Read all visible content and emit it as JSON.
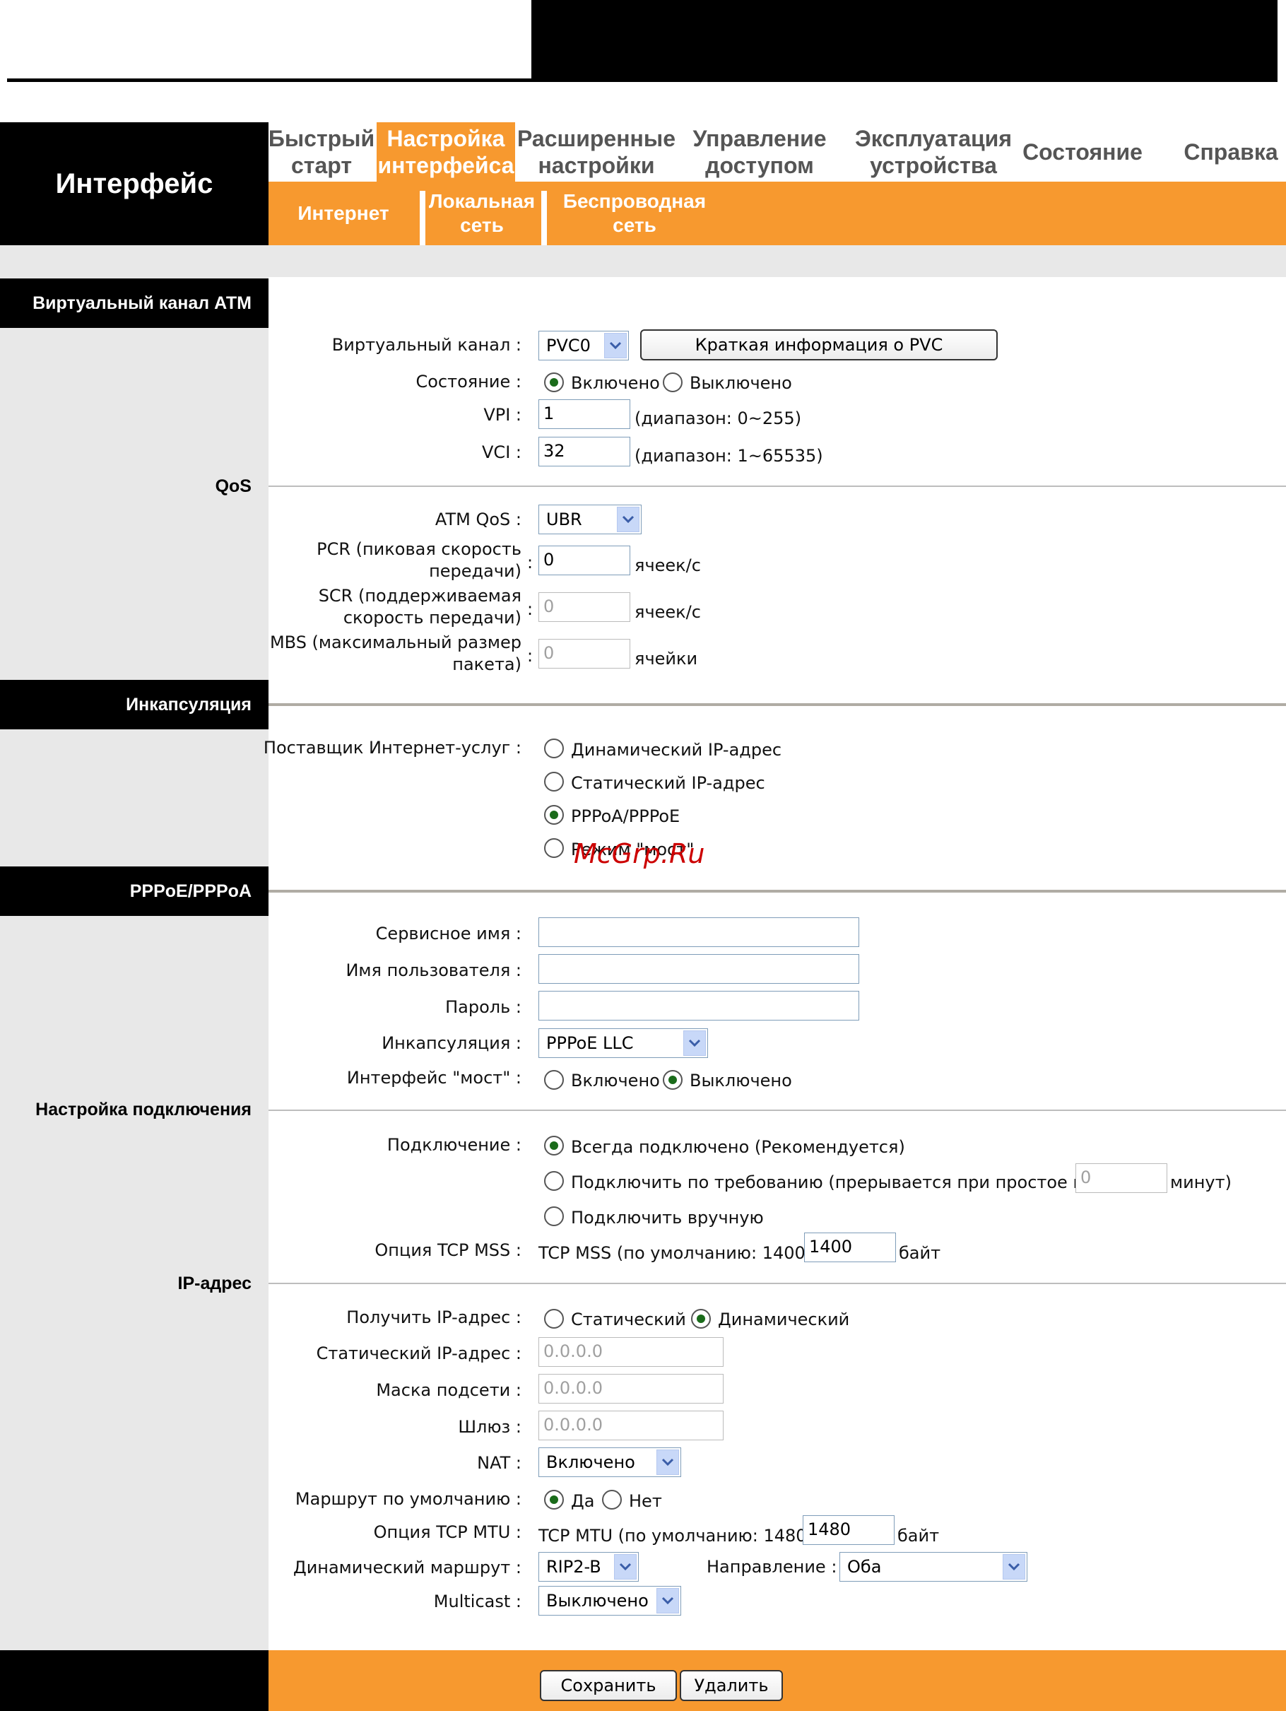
{
  "nav": {
    "brand": "Интерфейс",
    "tabs": [
      {
        "line1": "Быстрый",
        "line2": "старт"
      },
      {
        "line1": "Настройка",
        "line2": "интерфейса"
      },
      {
        "line1": "Расширенные",
        "line2": "настройки"
      },
      {
        "line1": "Управление",
        "line2": "доступом"
      },
      {
        "line1": "Эксплуатация",
        "line2": "устройства"
      },
      {
        "line1": "Состояние",
        "line2": ""
      },
      {
        "line1": "Справка",
        "line2": ""
      }
    ],
    "subtabs": [
      {
        "line1": "Интернет",
        "line2": ""
      },
      {
        "line1": "Локальная",
        "line2": "сеть"
      },
      {
        "line1": "Беспроводная",
        "line2": "сеть"
      }
    ]
  },
  "sections": {
    "atm": "Виртуальный канал АТМ",
    "qos": "QoS",
    "encap": "Инкапсуляция",
    "pppoe": "PPPoE/PPPoA",
    "conn": "Настройка подключения",
    "ip": "IP-адрес"
  },
  "atm": {
    "vc_label": "Виртуальный канал",
    "vc_value": "PVC0",
    "pvc_button": "Краткая информация о PVC",
    "status_label": "Состояние",
    "status_on": "Включено",
    "status_off": "Выключено",
    "vpi_label": "VPI",
    "vpi_value": "1",
    "vpi_range": "(диапазон: 0~255)",
    "vci_label": "VCI",
    "vci_value": "32",
    "vci_range": "(диапазон: 1~65535)"
  },
  "qos": {
    "atm_qos_label": "ATM QoS",
    "atm_qos_value": "UBR",
    "pcr_label_1": "PCR (пиковая скорость",
    "pcr_label_2": "передачи)",
    "pcr_value": "0",
    "pcr_unit": "ячеек/с",
    "scr_label_1": "SCR (поддерживаемая",
    "scr_label_2": "скорость передачи)",
    "scr_value": "0",
    "scr_unit": "ячеек/с",
    "mbs_label_1": "MBS (максимальный размер",
    "mbs_label_2": "пакета)",
    "mbs_value": "0",
    "mbs_unit": "ячейки"
  },
  "encap": {
    "isp_label": "Поставщик Интернет-услуг",
    "opt_dynamic": "Динамический IP-адрес",
    "opt_static": "Статический IP-адрес",
    "opt_pppoa": "PPPoA/PPPoE",
    "opt_bridge": "Режим \"мост\""
  },
  "watermark": "McGrp.Ru",
  "pppoe": {
    "service_label": "Сервисное имя",
    "service_value": "",
    "user_label": "Имя пользователя",
    "user_value": "",
    "pass_label": "Пароль",
    "pass_value": "",
    "encap_label": "Инкапсуляция",
    "encap_value": "PPPoE LLC",
    "bridge_label": "Интерфейс \"мост\"",
    "bridge_on": "Включено",
    "bridge_off": "Выключено"
  },
  "conn": {
    "label": "Подключение",
    "always": "Всегда подключено (Рекомендуется)",
    "ondemand": "Подключить по требованию (прерывается при простое в",
    "idle_value": "0",
    "idle_unit": "минут)",
    "manual": "Подключить вручную",
    "mss_label": "Опция TCP MSS",
    "mss_default": "TCP MSS (по умолчанию: 1400)",
    "mss_value": "1400",
    "mss_unit": "байт"
  },
  "ip": {
    "get_label": "Получить IP-адрес",
    "get_static": "Статический",
    "get_dynamic": "Динамический",
    "static_label": "Статический IP-адрес",
    "static_value": "0.0.0.0",
    "mask_label": "Маска подсети",
    "mask_value": "0.0.0.0",
    "gw_label": "Шлюз",
    "gw_value": "0.0.0.0",
    "nat_label": "NAT",
    "nat_value": "Включено",
    "route_label": "Маршрут по умолчанию",
    "route_yes": "Да",
    "route_no": "Нет",
    "mtu_label": "Опция TCP MTU",
    "mtu_default": "TCP MTU (по умолчанию: 1480)",
    "mtu_value": "1480",
    "mtu_unit": "байт",
    "dynroute_label": "Динамический маршрут",
    "dynroute_value": "RIP2-B",
    "direction_label": "Направление",
    "direction_value": "Оба",
    "multicast_label": "Multicast",
    "multicast_value": "Выключено"
  },
  "footer": {
    "save": "Сохранить",
    "delete": "Удалить"
  }
}
